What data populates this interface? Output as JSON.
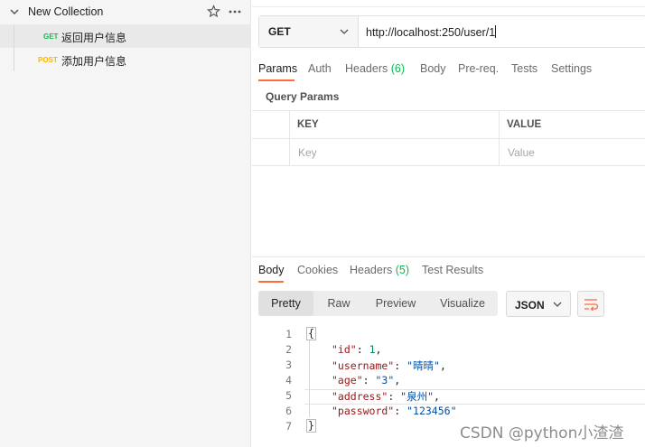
{
  "sidebar": {
    "collection_name": "New Collection",
    "requests": [
      {
        "method": "GET",
        "name": "返回用户信息",
        "method_color": "#0cbb52"
      },
      {
        "method": "POST",
        "name": "添加用户信息",
        "method_color": "#ffb400"
      }
    ]
  },
  "request": {
    "method": "GET",
    "url": "http://localhost:250/user/1"
  },
  "request_tabs": [
    {
      "label": "Params"
    },
    {
      "label": "Auth"
    },
    {
      "label": "Headers",
      "count": "(6)"
    },
    {
      "label": "Body"
    },
    {
      "label": "Pre-req."
    },
    {
      "label": "Tests"
    },
    {
      "label": "Settings"
    }
  ],
  "query_params": {
    "title": "Query Params",
    "col_key": "KEY",
    "col_value": "VALUE",
    "key_placeholder": "Key",
    "value_placeholder": "Value"
  },
  "response_tabs": [
    {
      "label": "Body"
    },
    {
      "label": "Cookies"
    },
    {
      "label": "Headers",
      "count": "(5)"
    },
    {
      "label": "Test Results"
    }
  ],
  "view_modes": [
    "Pretty",
    "Raw",
    "Preview",
    "Visualize"
  ],
  "language": "JSON",
  "response_lines": {
    "numbers": [
      "1",
      "2",
      "3",
      "4",
      "5",
      "6",
      "7"
    ],
    "open": "{",
    "close": "}",
    "fields": [
      {
        "key": "\"id\"",
        "value": "1",
        "kind": "number",
        "comma": ","
      },
      {
        "key": "\"username\"",
        "value": "\"晴晴\"",
        "kind": "string",
        "comma": ","
      },
      {
        "key": "\"age\"",
        "value": "\"3\"",
        "kind": "string",
        "comma": ","
      },
      {
        "key": "\"address\"",
        "value": "\"泉州\"",
        "kind": "string",
        "comma": ","
      },
      {
        "key": "\"password\"",
        "value": "\"123456\"",
        "kind": "string",
        "comma": ""
      }
    ]
  },
  "watermark": "CSDN @python小渣渣",
  "colors": {
    "accent": "#ff6c37",
    "success": "#0cbb52",
    "post": "#ffb400"
  }
}
